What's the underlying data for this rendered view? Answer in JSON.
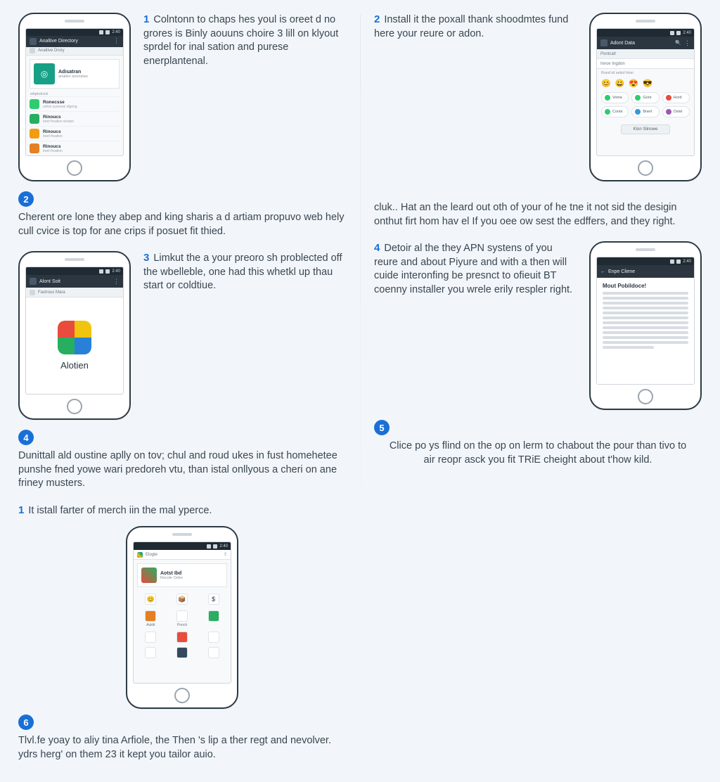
{
  "left": {
    "step1": {
      "num": "1",
      "text": "Colntonn to chaps hes youl is oreet d no grores is Binly aouuns choire 3 lill on klyout sprdel for inal sation and purese enerplantenal."
    },
    "badge2": "2",
    "para2": "Cherent ore lone they abep and king sharis a d artiam propuvo web hely cull cvice is top for ane crips if posuet fit thied.",
    "step3": {
      "num": "3",
      "text": "Limkut the a your preoro sh problected off the wbelleble, one had this whetkl up thau start or coldtiue."
    },
    "badge4": "4",
    "para4": "Dunittall ald oustine aplly on tov; chul and roud ukes in fust homehetee punshe fned yowe wari predoreh vtu, than istal onllyous a cheri on ane friney musters.",
    "step_footer": {
      "num": "1",
      "text": "It istall farter of merch iin the mal yperce."
    },
    "badge6": "6",
    "para6": "Tlvl.fe yoay to aliy tina Arfiole, the Then 's lip a ther regt and nevolver. ydrs herg' on them 23 it kept you tailor auio."
  },
  "right": {
    "step2": {
      "num": "2",
      "text": "Install it the poxall thank shoodmtes fund here your reure or adon."
    },
    "para_cluk": "cluk.. Hat an the leard out oth of your of he tne it not sid the desigin onthut firt hom hav el If you oee ow sest the edffers, and they right.",
    "step4": {
      "num": "4",
      "text": "Detoir al the they APN systens of you reure and about Piyure and with a then will cuide interonfing be presnct to ofieuit BT coenny installer you wrele erily respler right."
    },
    "badge5": "5",
    "para5": "Clice po ys flind on the op on lerm to chabout the pour than tivo to air reopr asck you fit TRiE cheight about t'how kild."
  },
  "phones": {
    "p1": {
      "title": "Analtive Directory",
      "time": "2:40",
      "sub": "Analtive Drory",
      "card": {
        "title": "Adisatran",
        "sub": "analtev anonstan"
      },
      "section": "whptolcick",
      "items": [
        {
          "color": "#2ecc71",
          "t": "Ronecsse",
          "s": "unhor purouse olgring"
        },
        {
          "color": "#27ae60",
          "t": "Rinoucs",
          "s": "loret freation dcoten"
        },
        {
          "color": "#f39c12",
          "t": "Rinoucs",
          "s": "loret freation"
        },
        {
          "color": "#e67e22",
          "t": "Rinoucs",
          "s": "loret freation"
        }
      ]
    },
    "p2": {
      "title": "Adont Data",
      "time": "2:40",
      "tabs": [
        "Pontcatl",
        "Innov Ingdon"
      ],
      "row_label": "Rund td setiol hton",
      "emoji_row": [
        "😊",
        "😀",
        "😍",
        "😎"
      ],
      "chips": [
        {
          "c": "#2ecc71",
          "t": "Vome"
        },
        {
          "c": "#2ecc71",
          "t": "Gont"
        },
        {
          "c": "#e74c3c",
          "t": "Hord"
        },
        {
          "c": "#2ecc71",
          "t": "Conte"
        },
        {
          "c": "#3498db",
          "t": "Bnert"
        },
        {
          "c": "#9b59b6",
          "t": "Ostel"
        }
      ],
      "button": "Klon Slinowe"
    },
    "p3": {
      "title": "Alont Soit",
      "time": "2:40",
      "sub": "Faxtrous Mara",
      "logo_label": "Alotien"
    },
    "p4": {
      "title": "Enpe Cliene",
      "time": "2:40",
      "heading": "Mout Pobildoce!"
    },
    "p5": {
      "title": "Elogte",
      "time": "2:40",
      "card": {
        "title": "Aotst Ibd",
        "sub": "Recole Oolre"
      },
      "row1": [
        "😊",
        "📦",
        "$"
      ],
      "apps": [
        "Auktit",
        "Poncti",
        "",
        "",
        "",
        "",
        "",
        "",
        ""
      ]
    }
  }
}
